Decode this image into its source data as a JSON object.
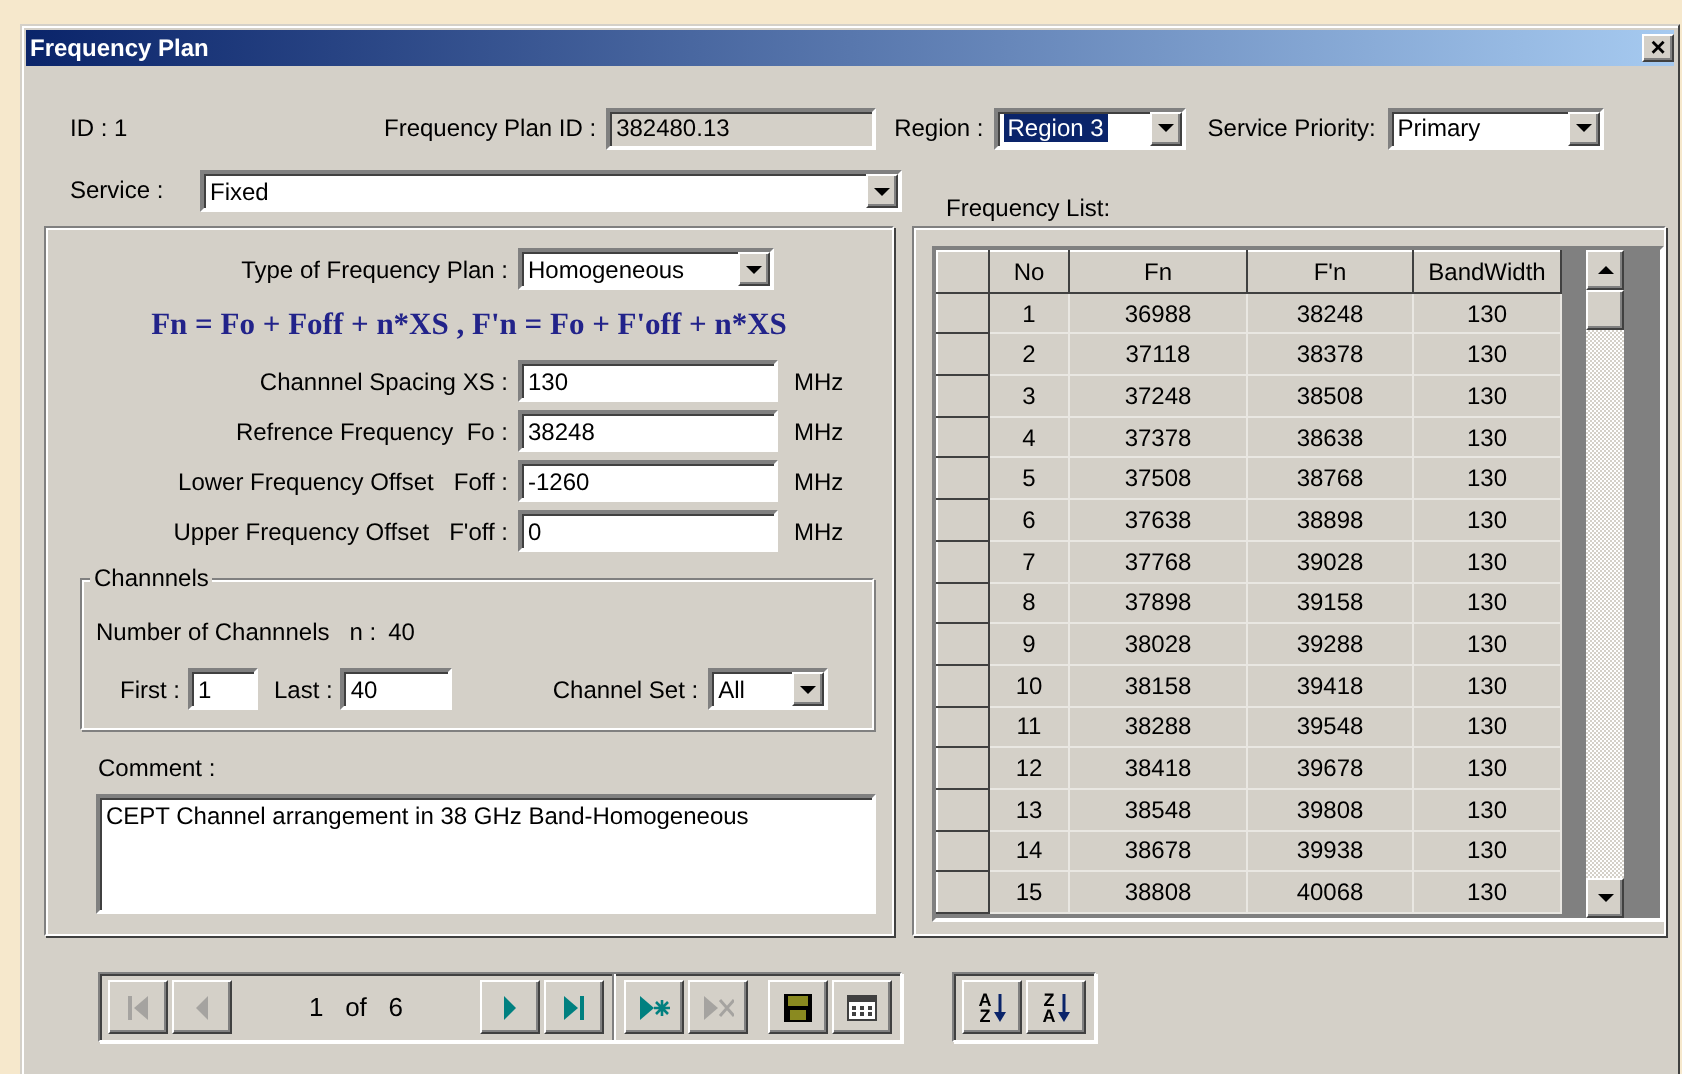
{
  "window": {
    "title": "Frequency Plan",
    "close": "×"
  },
  "header": {
    "id_label": "ID : 1",
    "plan_id_label": "Frequency Plan ID :",
    "plan_id": "382480.13",
    "region_label": "Region :",
    "region": "Region 3",
    "region_highlighted": true,
    "priority_label": "Service Priority:",
    "priority": "Primary",
    "service_label": "Service :",
    "service": "Fixed"
  },
  "plan": {
    "type_label": "Type of Frequency Plan :",
    "type": "Homogeneous",
    "formula": "Fn = Fo + Foff + n*XS , F'n = Fo + F'off + n*XS",
    "fields": [
      {
        "label": "Channnel Spacing XS :",
        "value": "130",
        "unit": "MHz"
      },
      {
        "label": "Refrence Frequency  Fo :",
        "value": "38248",
        "unit": "MHz"
      },
      {
        "label": "Lower Frequency Offset   Foff :",
        "value": "-1260",
        "unit": "MHz"
      },
      {
        "label": "Upper Frequency Offset   F'off :",
        "value": "0",
        "unit": "MHz"
      }
    ],
    "channels": {
      "title": "Channnels",
      "count_label": "Number of Channnels   n :",
      "count": "40",
      "first_label": "First :",
      "first": "1",
      "last_label": "Last :",
      "last": "40",
      "set_label": "Channel Set :",
      "set": "All"
    },
    "comment_label": "Comment :",
    "comment": "CEPT Channel arrangement in 38 GHz Band-Homogeneous"
  },
  "frequency_list": {
    "label": "Frequency List:",
    "columns": [
      "No",
      "Fn",
      "F'n",
      "BandWidth"
    ],
    "rows": [
      [
        "1",
        "36988",
        "38248",
        "130"
      ],
      [
        "2",
        "37118",
        "38378",
        "130"
      ],
      [
        "3",
        "37248",
        "38508",
        "130"
      ],
      [
        "4",
        "37378",
        "38638",
        "130"
      ],
      [
        "5",
        "37508",
        "38768",
        "130"
      ],
      [
        "6",
        "37638",
        "38898",
        "130"
      ],
      [
        "7",
        "37768",
        "39028",
        "130"
      ],
      [
        "8",
        "37898",
        "39158",
        "130"
      ],
      [
        "9",
        "38028",
        "39288",
        "130"
      ],
      [
        "10",
        "38158",
        "39418",
        "130"
      ],
      [
        "11",
        "38288",
        "39548",
        "130"
      ],
      [
        "12",
        "38418",
        "39678",
        "130"
      ],
      [
        "13",
        "38548",
        "39808",
        "130"
      ],
      [
        "14",
        "38678",
        "39938",
        "130"
      ],
      [
        "15",
        "38808",
        "40068",
        "130"
      ]
    ]
  },
  "navigator": {
    "position": "1   of   6",
    "buttons": [
      {
        "kind": "first",
        "disabled": true
      },
      {
        "kind": "previous",
        "disabled": true
      },
      {
        "kind": "next",
        "disabled": false
      },
      {
        "kind": "last",
        "disabled": false
      },
      {
        "kind": "add",
        "disabled": false
      },
      {
        "kind": "delete",
        "disabled": true
      },
      {
        "kind": "save",
        "disabled": false
      },
      {
        "kind": "grid",
        "disabled": false
      }
    ]
  },
  "sort_buttons": [
    {
      "top": "A",
      "bottom": "Z"
    },
    {
      "top": "Z",
      "bottom": "A"
    }
  ]
}
